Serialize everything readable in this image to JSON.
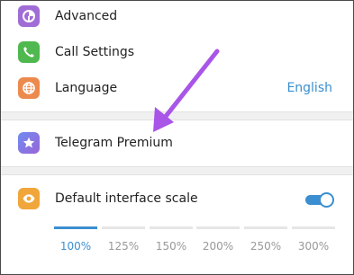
{
  "settings": {
    "advanced": {
      "label": "Advanced",
      "icon": "pie-chart-icon",
      "icon_color": "#a06dd6"
    },
    "call_settings": {
      "label": "Call Settings",
      "icon": "phone-icon",
      "icon_color": "#4fb84f"
    },
    "language": {
      "label": "Language",
      "value": "English",
      "icon": "globe-icon",
      "icon_color": "#ec8a4d"
    },
    "premium": {
      "label": "Telegram Premium",
      "icon": "star-icon",
      "icon_color": "#7d7be0"
    },
    "interface_scale": {
      "label": "Default interface scale",
      "icon": "eye-icon",
      "icon_color": "#f0a63a",
      "toggle_on": true,
      "options": [
        "100%",
        "125%",
        "150%",
        "200%",
        "250%",
        "300%"
      ],
      "selected": "100%"
    }
  },
  "colors": {
    "accent": "#3b8fd0",
    "annotation_arrow": "#a855e8"
  }
}
